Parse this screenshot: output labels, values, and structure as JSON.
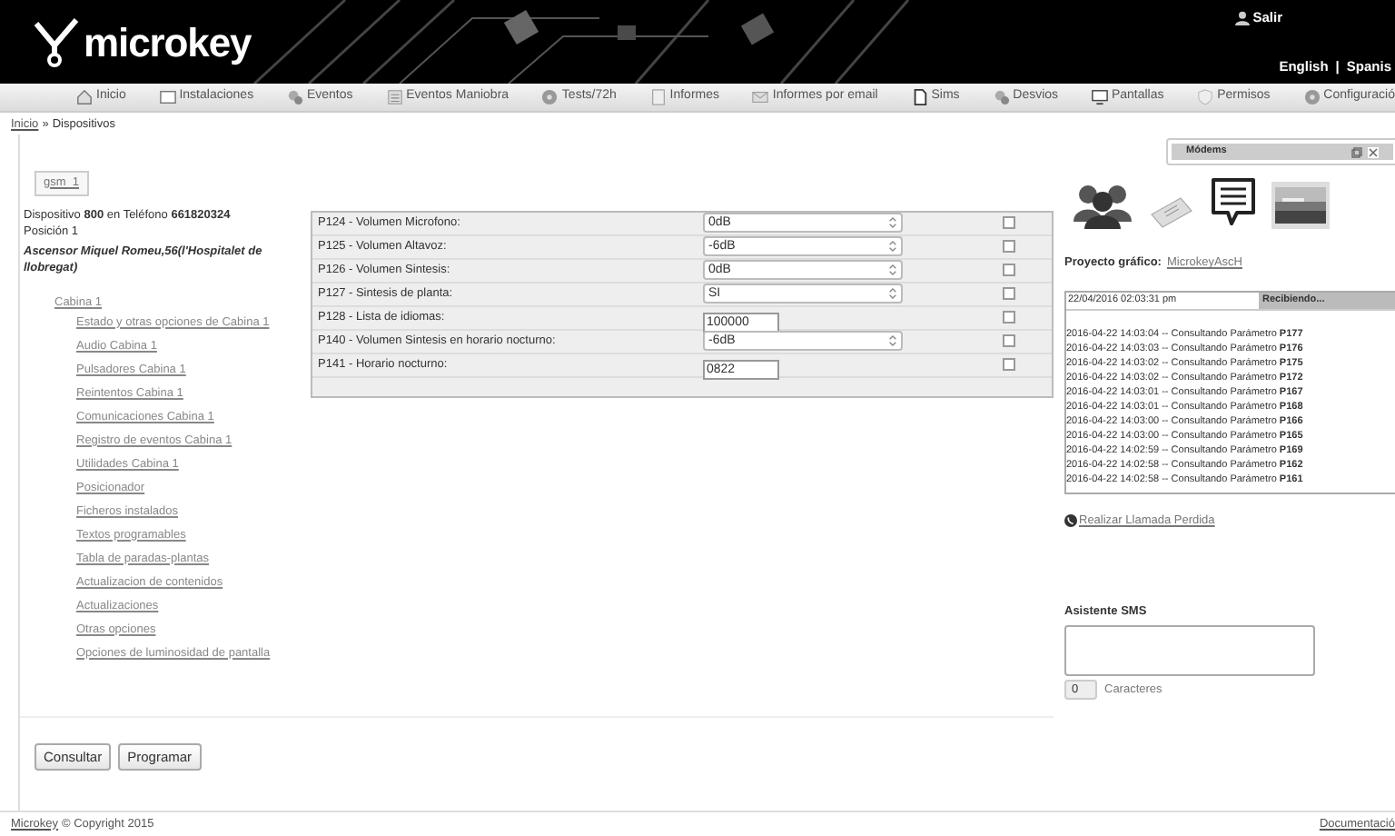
{
  "header": {
    "logo": "microkey",
    "logout": "Salir",
    "languages": [
      "English",
      "Spanis"
    ],
    "separator": "|"
  },
  "nav": [
    {
      "label": "Inicio",
      "kind": "home"
    },
    {
      "label": "Instalaciones",
      "kind": "window"
    },
    {
      "label": "Eventos",
      "kind": "gears"
    },
    {
      "label": "Eventos Maniobra",
      "kind": "list"
    },
    {
      "label": "Tests/72h",
      "kind": "disc"
    },
    {
      "label": "Informes",
      "kind": "doc"
    },
    {
      "label": "Informes por email",
      "kind": "mail"
    },
    {
      "label": "Sims",
      "kind": "sim"
    },
    {
      "label": "Desvios",
      "kind": "gears"
    },
    {
      "label": "Pantallas",
      "kind": "monitor"
    },
    {
      "label": "Permisos",
      "kind": "shield"
    },
    {
      "label": "Configuració",
      "kind": "disc"
    }
  ],
  "breadcrumb": {
    "link": "Inicio",
    "separator": "»",
    "current": "Dispositivos"
  },
  "device_tab": "gsm  1",
  "device_info": "Dispositivo **800** en Teléfono **661820324** Posición 1",
  "device_location": "Ascensor Miquel Romeu,56(l'Hospitalet de llobregat)",
  "tree": [
    {
      "label": "Cabina 1",
      "children": [
        {
          "label": "Estado y otras opciones de Cabina 1"
        },
        {
          "label": "Audio Cabina 1"
        },
        {
          "label": "Pulsadores Cabina 1"
        },
        {
          "label": "Reintentos Cabina 1"
        },
        {
          "label": "Comunicaciones Cabina 1"
        },
        {
          "label": "Registro de eventos Cabina 1"
        },
        {
          "label": "Utilidades Cabina 1"
        },
        {
          "label": "Posicionador"
        },
        {
          "label": "Ficheros instalados"
        },
        {
          "label": "Textos programables"
        },
        {
          "label": "Tabla de paradas-plantas"
        },
        {
          "label": "Actualizacion de contenidos"
        },
        {
          "label": "Actualizaciones"
        },
        {
          "label": "Otras opciones"
        },
        {
          "label": "Opciones de luminosidad de pantalla"
        }
      ]
    }
  ],
  "parameters": [
    {
      "label": "P124 - Volumen Microfono:",
      "kind": "select",
      "value": "0dB",
      "checked": false
    },
    {
      "label": "P125 - Volumen Altavoz:",
      "kind": "select",
      "value": "-6dB",
      "checked": false
    },
    {
      "label": "P126 - Volumen Sintesis:",
      "kind": "select",
      "value": "0dB",
      "checked": false
    },
    {
      "label": "P127 - Sintesis de planta:",
      "kind": "select",
      "value": "SI",
      "checked": false
    },
    {
      "label": "P128 - Lista de idiomas:",
      "kind": "input",
      "value": "100000",
      "checked": false
    },
    {
      "label": "P140 - Volumen Sintesis en horario nocturno:",
      "kind": "select",
      "value": "-6dB",
      "checked": false
    },
    {
      "label": "P141 - Horario nocturno:",
      "kind": "input",
      "value": "0822",
      "checked": false
    }
  ],
  "buttons": [
    "Consultar",
    "Programar"
  ],
  "modem_window": {
    "title": "Módems"
  },
  "project": {
    "label": "Proyecto gráfico:",
    "link": "MicrokeyAscH"
  },
  "log": {
    "date": "22/04/2016 02:03:31 pm",
    "status": "Recibiendo...",
    "lines": [
      "2016-04-22 14:03:04 -- Consultando Parámetro **P177**",
      "2016-04-22 14:03:03 -- Consultando Parámetro **P176**",
      "2016-04-22 14:03:02 -- Consultando Parámetro **P175**",
      "2016-04-22 14:03:02 -- Consultando Parámetro **P172**",
      "2016-04-22 14:03:01 -- Consultando Parámetro **P167**",
      "2016-04-22 14:03:01 -- Consultando Parámetro **P168**",
      "2016-04-22 14:03:00 -- Consultando Parámetro **P166**",
      "2016-04-22 14:03:00 -- Consultando Parámetro **P165**",
      "2016-04-22 14:02:59 -- Consultando Parámetro **P169**",
      "2016-04-22 14:02:58 -- Consultando Parámetro **P162**",
      "2016-04-22 14:02:58 -- Consultando Parámetro **P161**"
    ]
  },
  "missed_call_link": "Realizar Llamada Perdida",
  "sms": {
    "title": "Asistente SMS",
    "count": "0",
    "count_label": "Caracteres"
  },
  "footer": {
    "link": "Microkey",
    "text": "© Copyright 2015",
    "docs": "Documentació"
  }
}
